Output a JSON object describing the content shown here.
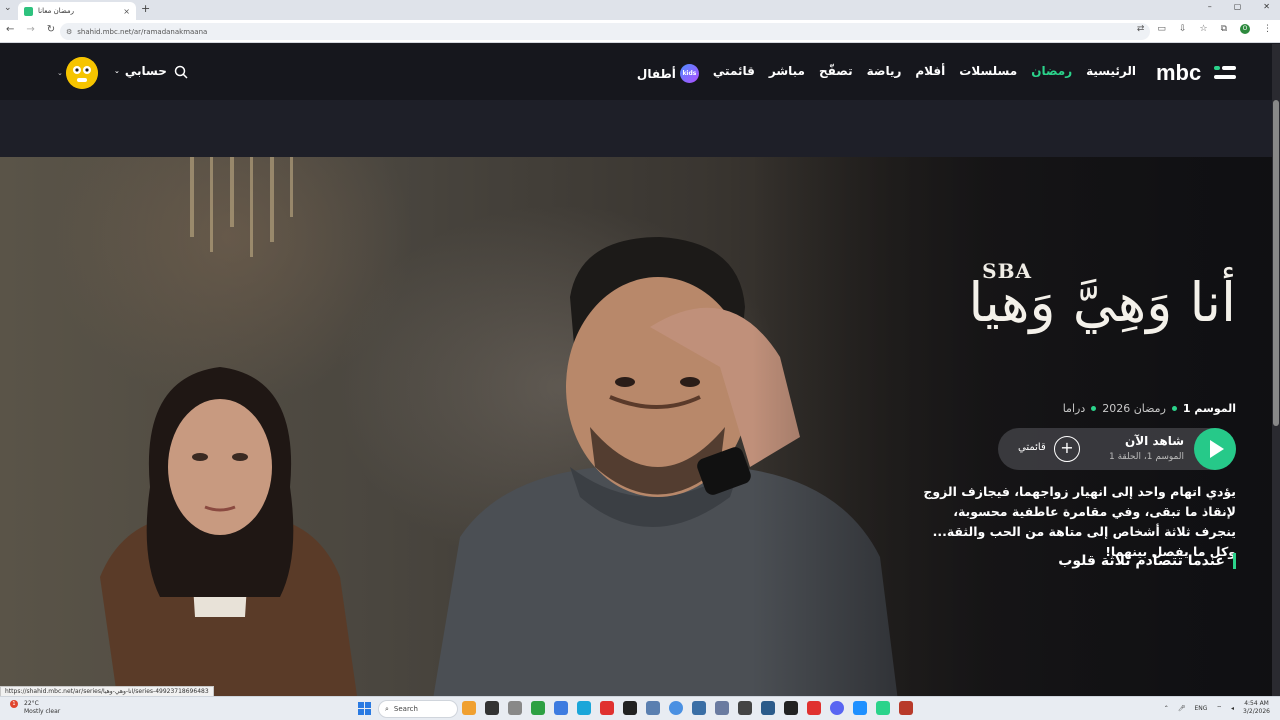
{
  "browser": {
    "tab_title": "رمضان معانا",
    "tab_close": "×",
    "new_tab": "+",
    "url": "shahid.mbc.net/ar/ramadanakmaana",
    "window_controls": [
      "–",
      "▢",
      "✕"
    ]
  },
  "header": {
    "logo_text": "mbc",
    "nav": [
      {
        "label": "الرئيسية"
      },
      {
        "label": "رمضان"
      },
      {
        "label": "مسلسلات"
      },
      {
        "label": "أفلام"
      },
      {
        "label": "رياضة"
      },
      {
        "label": "تصفّح"
      },
      {
        "label": "مباشر"
      },
      {
        "label": "قائمتي"
      },
      {
        "label": "أطفال"
      }
    ],
    "kids_badge": "kids",
    "account_label": "حسابي"
  },
  "hero": {
    "sponsor": "SBA",
    "title": "أنا وَهِيَّ وَهيا",
    "meta": [
      "الموسم 1",
      "رمضان 2026",
      "دراما"
    ],
    "watch_now": "شاهد الآن",
    "episode": "الموسم 1، الحلقة 1",
    "add_symbol": "+",
    "my_list": "قائمتي",
    "synopsis": "يؤدي اتهام واحد إلى انهيار زواجهما، فيجازف الزوج لإنقاذ ما تبقى، وفي مقامرة عاطفية محسوبة، ينجرف ثلاثة أشخاص إلى متاهة من الحب والثقة... وكل ما يفصل بينهما!",
    "tagline": "عندما تتصادم ثلاثة قلوب"
  },
  "status_url": "https://shahid.mbc.net/ar/series/انا-وهي-وهيا/series-49923718696483",
  "taskbar": {
    "weather_temp": "22°C",
    "weather_text": "Mostly clear",
    "weather_badge": "1",
    "search": "Search",
    "lang": "ENG",
    "time": "4:54 AM",
    "date": "3/2/2026",
    "app_colors": [
      "#f0a030",
      "#333333",
      "#888888",
      "#2ea043",
      "#3d7be0",
      "#1ba6d9",
      "#e0312f",
      "#222222",
      "#5a7fb0",
      "#4a90e2",
      "#3a6ea5",
      "#6a7ba0",
      "#444444",
      "#2b5b8a",
      "#222222",
      "#e0312f",
      "#5865f2",
      "#1e90ff",
      "#2bd38b",
      "#b83a2a"
    ]
  },
  "colors": {
    "accent": "#2bd38b",
    "header_bg": "#16171d"
  }
}
